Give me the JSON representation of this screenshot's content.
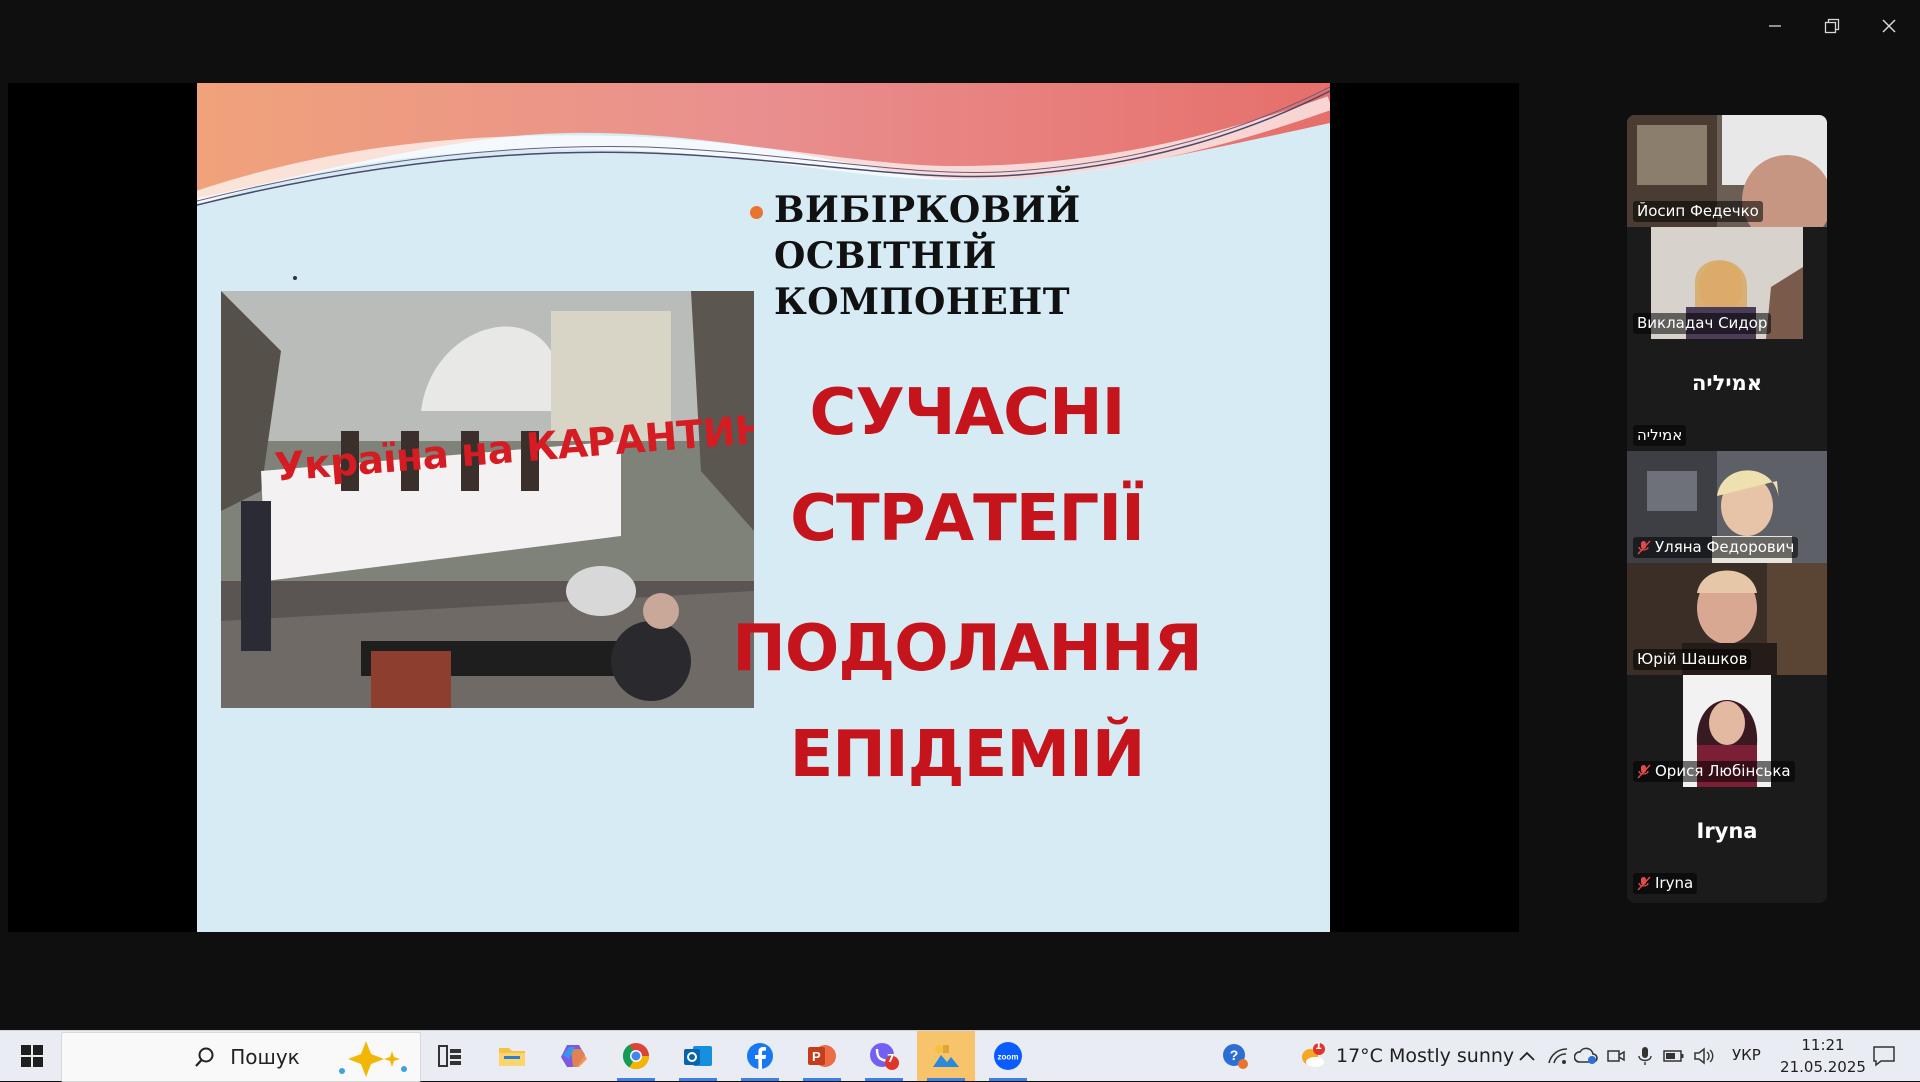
{
  "slide": {
    "heading": "ВИБІРКОВИЙ ОСВІТНІЙ КОМПОНЕНТ",
    "line1": "СУЧАСНІ",
    "line2": "СТРАТЕГІЇ",
    "line3": "ПОДОЛАННЯ",
    "line4": "ЕПІДЕМІЙ",
    "photo_banner": "Україна на КАРАНТИНІ"
  },
  "participants": [
    {
      "name": "Йосип Федечко",
      "muted": false,
      "video": true
    },
    {
      "name": "Викладач Сидор",
      "muted": false,
      "video": true
    },
    {
      "name": "אמיליה",
      "display_name": "אמיליה",
      "muted": false,
      "video": false
    },
    {
      "name": "Уляна Федорович",
      "muted": true,
      "video": true
    },
    {
      "name": "Юрій Шашков",
      "muted": false,
      "video": true,
      "active": true
    },
    {
      "name": "Орися Любінська",
      "muted": true,
      "video": true
    },
    {
      "name": "Iryna",
      "display_name": "Iryna",
      "muted": true,
      "video": false
    }
  ],
  "taskbar": {
    "search_placeholder": "Пошук",
    "weather": "17°C  Mostly sunny",
    "language": "УКР",
    "time": "11:21",
    "date": "21.05.2025",
    "viber_badge": "7",
    "weather_badge": "1"
  },
  "colors": {
    "accent_red": "#c5141b",
    "active_speaker": "#23d160",
    "slide_bg": "#d6ebf4"
  }
}
